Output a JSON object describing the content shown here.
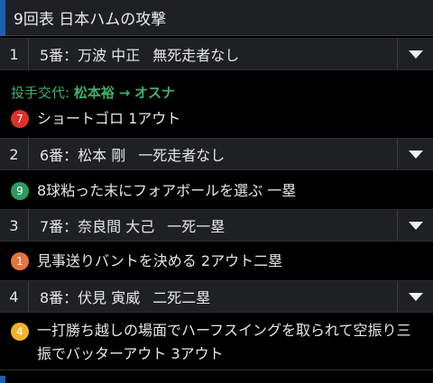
{
  "header": {
    "title": "9回表 日本ハムの攻撃"
  },
  "pitcher_change": {
    "label": "投手交代:",
    "from": "松本裕",
    "arrow": "→",
    "to": "オスナ"
  },
  "at_bats": [
    {
      "num": "1",
      "batter": "5番：万波 中正",
      "situation": "無死走者なし"
    },
    {
      "num": "2",
      "batter": "6番：松本 剛",
      "situation": "一死走者なし"
    },
    {
      "num": "3",
      "batter": "7番：奈良間 大己",
      "situation": "一死一塁"
    },
    {
      "num": "4",
      "batter": "8番：伏見 寅威",
      "situation": "二死二塁"
    }
  ],
  "events": [
    {
      "badge": "7",
      "color": "#d9342b",
      "text": "ショートゴロ 1アウト"
    },
    {
      "badge": "9",
      "color": "#2e9a5e",
      "text": "8球粘った末にフォアボールを選ぶ 一塁"
    },
    {
      "badge": "1",
      "color": "#e8743b",
      "text": "見事送りバントを決める 2アウト二塁"
    },
    {
      "badge": "4",
      "color": "#f0b429",
      "text": "一打勝ち越しの場面でハーフスイングを取られて空振り三振でバッターアウト 3アウト"
    }
  ]
}
